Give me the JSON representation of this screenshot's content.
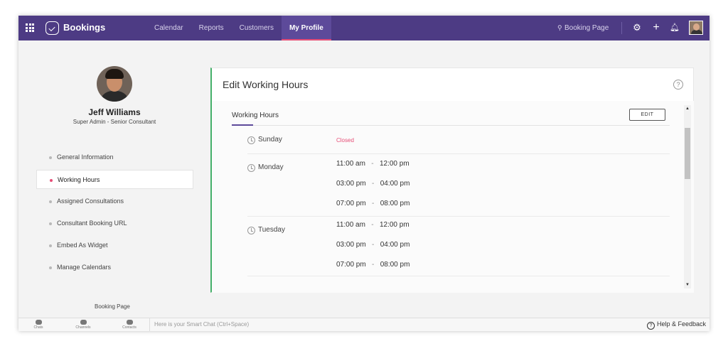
{
  "app": {
    "title": "Bookings"
  },
  "nav": {
    "items": [
      {
        "label": "Calendar",
        "active": false
      },
      {
        "label": "Reports",
        "active": false
      },
      {
        "label": "Customers",
        "active": false
      },
      {
        "label": "My Profile",
        "active": true
      }
    ]
  },
  "topbar": {
    "booking_page_label": "Booking Page"
  },
  "profile": {
    "name": "Jeff Williams",
    "role": "Super Admin - Senior Consultant"
  },
  "sidebar": {
    "items": [
      {
        "label": "General Information",
        "active": false
      },
      {
        "label": "Working Hours",
        "active": true
      },
      {
        "label": "Assigned Consultations",
        "active": false
      },
      {
        "label": "Consultant Booking URL",
        "active": false
      },
      {
        "label": "Embed As Widget",
        "active": false
      },
      {
        "label": "Manage Calendars",
        "active": false
      }
    ],
    "booking_page_label": "Booking Page"
  },
  "card": {
    "title": "Edit Working Hours",
    "help_label": "?",
    "tab_label": "Working Hours",
    "edit_label": "EDIT"
  },
  "schedule": {
    "sunday": {
      "day": "Sunday",
      "status": "Closed"
    },
    "monday": {
      "day": "Monday",
      "slots": [
        {
          "from": "11:00 am",
          "sep": "-",
          "to": "12:00 pm"
        },
        {
          "from": "03:00 pm",
          "sep": "-",
          "to": "04:00 pm"
        },
        {
          "from": "07:00 pm",
          "sep": "-",
          "to": "08:00 pm"
        }
      ]
    },
    "tuesday": {
      "day": "Tuesday",
      "slots": [
        {
          "from": "11:00 am",
          "sep": "-",
          "to": "12:00 pm"
        },
        {
          "from": "03:00 pm",
          "sep": "-",
          "to": "04:00 pm"
        },
        {
          "from": "07:00 pm",
          "sep": "-",
          "to": "08:00 pm"
        }
      ]
    }
  },
  "bottombar": {
    "chats_label": "Chats",
    "channels_label": "Channels",
    "contacts_label": "Contacts",
    "smart_chat_placeholder": "Here is your Smart Chat (Ctrl+Space)",
    "help_feedback_label": "Help & Feedback"
  },
  "colors": {
    "topbar_bg": "#4d3b84",
    "accent_pink": "#e64d76",
    "accent_green": "#45b06a",
    "tab_underline": "#5d4a9a"
  },
  "icons": [
    "apps-grid-icon",
    "bookings-logo-icon",
    "pin-icon",
    "gear-icon",
    "plus-icon",
    "bell-icon",
    "help-icon",
    "clock-icon",
    "chat-icon",
    "channels-icon",
    "contacts-icon"
  ]
}
